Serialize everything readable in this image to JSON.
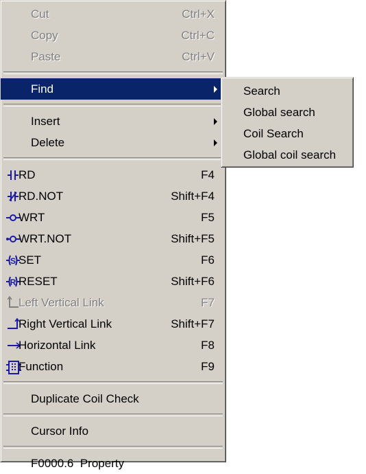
{
  "menu": {
    "clipboard": [
      {
        "label": "Cut",
        "shortcut": "Ctrl+X"
      },
      {
        "label": "Copy",
        "shortcut": "Ctrl+C"
      },
      {
        "label": "Paste",
        "shortcut": "Ctrl+V"
      }
    ],
    "find": {
      "label": "Find"
    },
    "insert": {
      "label": "Insert"
    },
    "delete": {
      "label": "Delete"
    },
    "ladder": [
      {
        "label": "RD",
        "shortcut": "F4",
        "icon": "contact-no-icon"
      },
      {
        "label": "RD.NOT",
        "shortcut": "Shift+F4",
        "icon": "contact-nc-icon"
      },
      {
        "label": "WRT",
        "shortcut": "F5",
        "icon": "coil-icon"
      },
      {
        "label": "WRT.NOT",
        "shortcut": "Shift+F5",
        "icon": "coil-not-icon"
      },
      {
        "label": "SET",
        "shortcut": "F6",
        "icon": "set-coil-icon"
      },
      {
        "label": "RESET",
        "shortcut": "Shift+F6",
        "icon": "reset-coil-icon"
      },
      {
        "label": "Left Vertical Link",
        "shortcut": "F7",
        "icon": "left-vertical-link-icon"
      },
      {
        "label": "Right Vertical Link",
        "shortcut": "Shift+F7",
        "icon": "right-vertical-link-icon"
      },
      {
        "label": "Horizontal Link",
        "shortcut": "F8",
        "icon": "horizontal-link-icon"
      },
      {
        "label": "Function",
        "shortcut": "F9",
        "icon": "function-block-icon"
      }
    ],
    "duplicate_coil_check": "Duplicate Coil Check",
    "cursor_info": "Cursor Info",
    "property": "F0000.6  Property"
  },
  "submenu": {
    "items": [
      "Search",
      "Global search",
      "Coil Search",
      "Global coil search"
    ]
  },
  "colors": {
    "menu_bg": "#d4d0c8",
    "highlight": "#0a246a",
    "disabled_text": "#808080"
  }
}
